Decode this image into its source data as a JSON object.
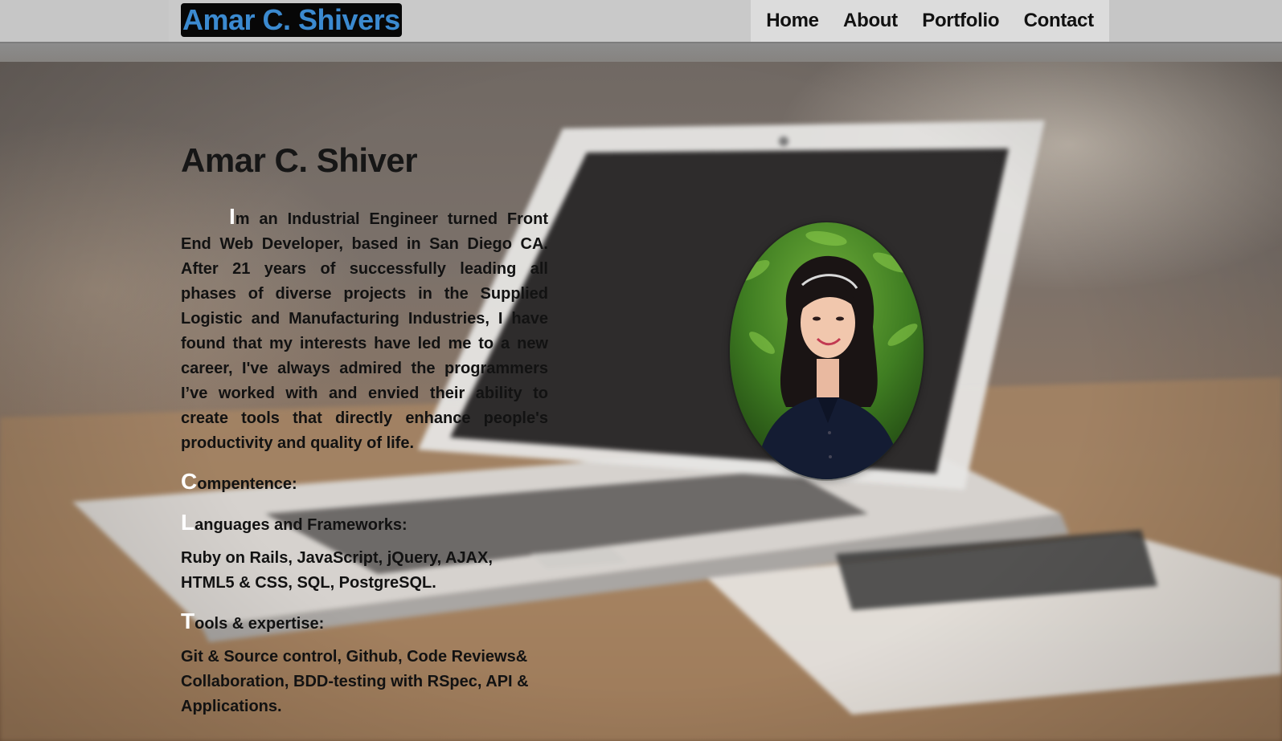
{
  "nav": {
    "brand": "Amar C. Shivers",
    "links": [
      "Home",
      "About",
      "Portfolio",
      "Contact"
    ]
  },
  "about": {
    "name": "Amar C. Shiver",
    "intro_first_letter": "I",
    "intro_rest": "m an Industrial Engineer turned Front End Web Developer, based in San Diego CA. After 21 years of successfully leading all phases of diverse projects in the Supplied Logistic and Manufacturing Industries, I have found that my interests have led me to a new career, I've always admired the programmers I’ve worked with and envied their ability to create tools that directly enhance people's productivity and quality of life.",
    "competence": {
      "cap": "C",
      "rest": "ompentence:"
    },
    "languages": {
      "cap": "L",
      "rest": "anguages and Frameworks:",
      "text": "Ruby on Rails, JavaScript, jQuery, AJAX, HTML5 & CSS, SQL, PostgreSQL."
    },
    "tools": {
      "cap": "T",
      "rest": "ools & expertise:",
      "text": "Git & Source control, Github, Code Reviews& Collaboration, BDD-testing with RSpec, API & Applications."
    }
  },
  "colors": {
    "brand_text": "#3b8ad0",
    "brand_bg": "#070707",
    "nav_bg": "#c9c9c9",
    "nav_links_bg": "#dcdcdc",
    "dropcap": "#ffffff"
  }
}
